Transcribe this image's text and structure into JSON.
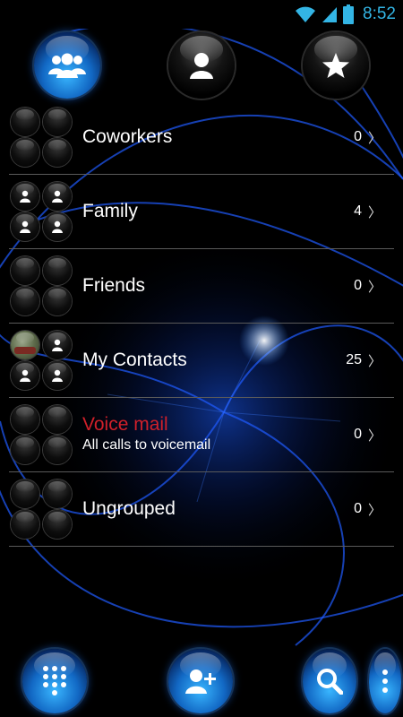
{
  "status": {
    "time": "8:52"
  },
  "tabs": [
    {
      "name": "groups",
      "icon": "groups-icon",
      "active": true
    },
    {
      "name": "contacts",
      "icon": "person-icon",
      "active": false
    },
    {
      "name": "favorites",
      "icon": "star-icon",
      "active": false
    }
  ],
  "groups": [
    {
      "name": "Coworkers",
      "count": "0"
    },
    {
      "name": "Family",
      "count": "4"
    },
    {
      "name": "Friends",
      "count": "0"
    },
    {
      "name": "My Contacts",
      "count": "25"
    },
    {
      "name": "Voice mail",
      "subtitle": "All calls to voicemail",
      "count": "0"
    },
    {
      "name": "Ungrouped",
      "count": "0"
    }
  ],
  "chevron": "〉",
  "bottom": [
    {
      "icon": "dialpad-icon"
    },
    {
      "icon": "add-contact-icon"
    },
    {
      "icon": "search-icon"
    },
    {
      "icon": "overflow-menu-icon"
    }
  ],
  "colors": {
    "accent": "#33b5e5",
    "voicemail": "#d0202a",
    "divider": "#5a5a5a"
  }
}
